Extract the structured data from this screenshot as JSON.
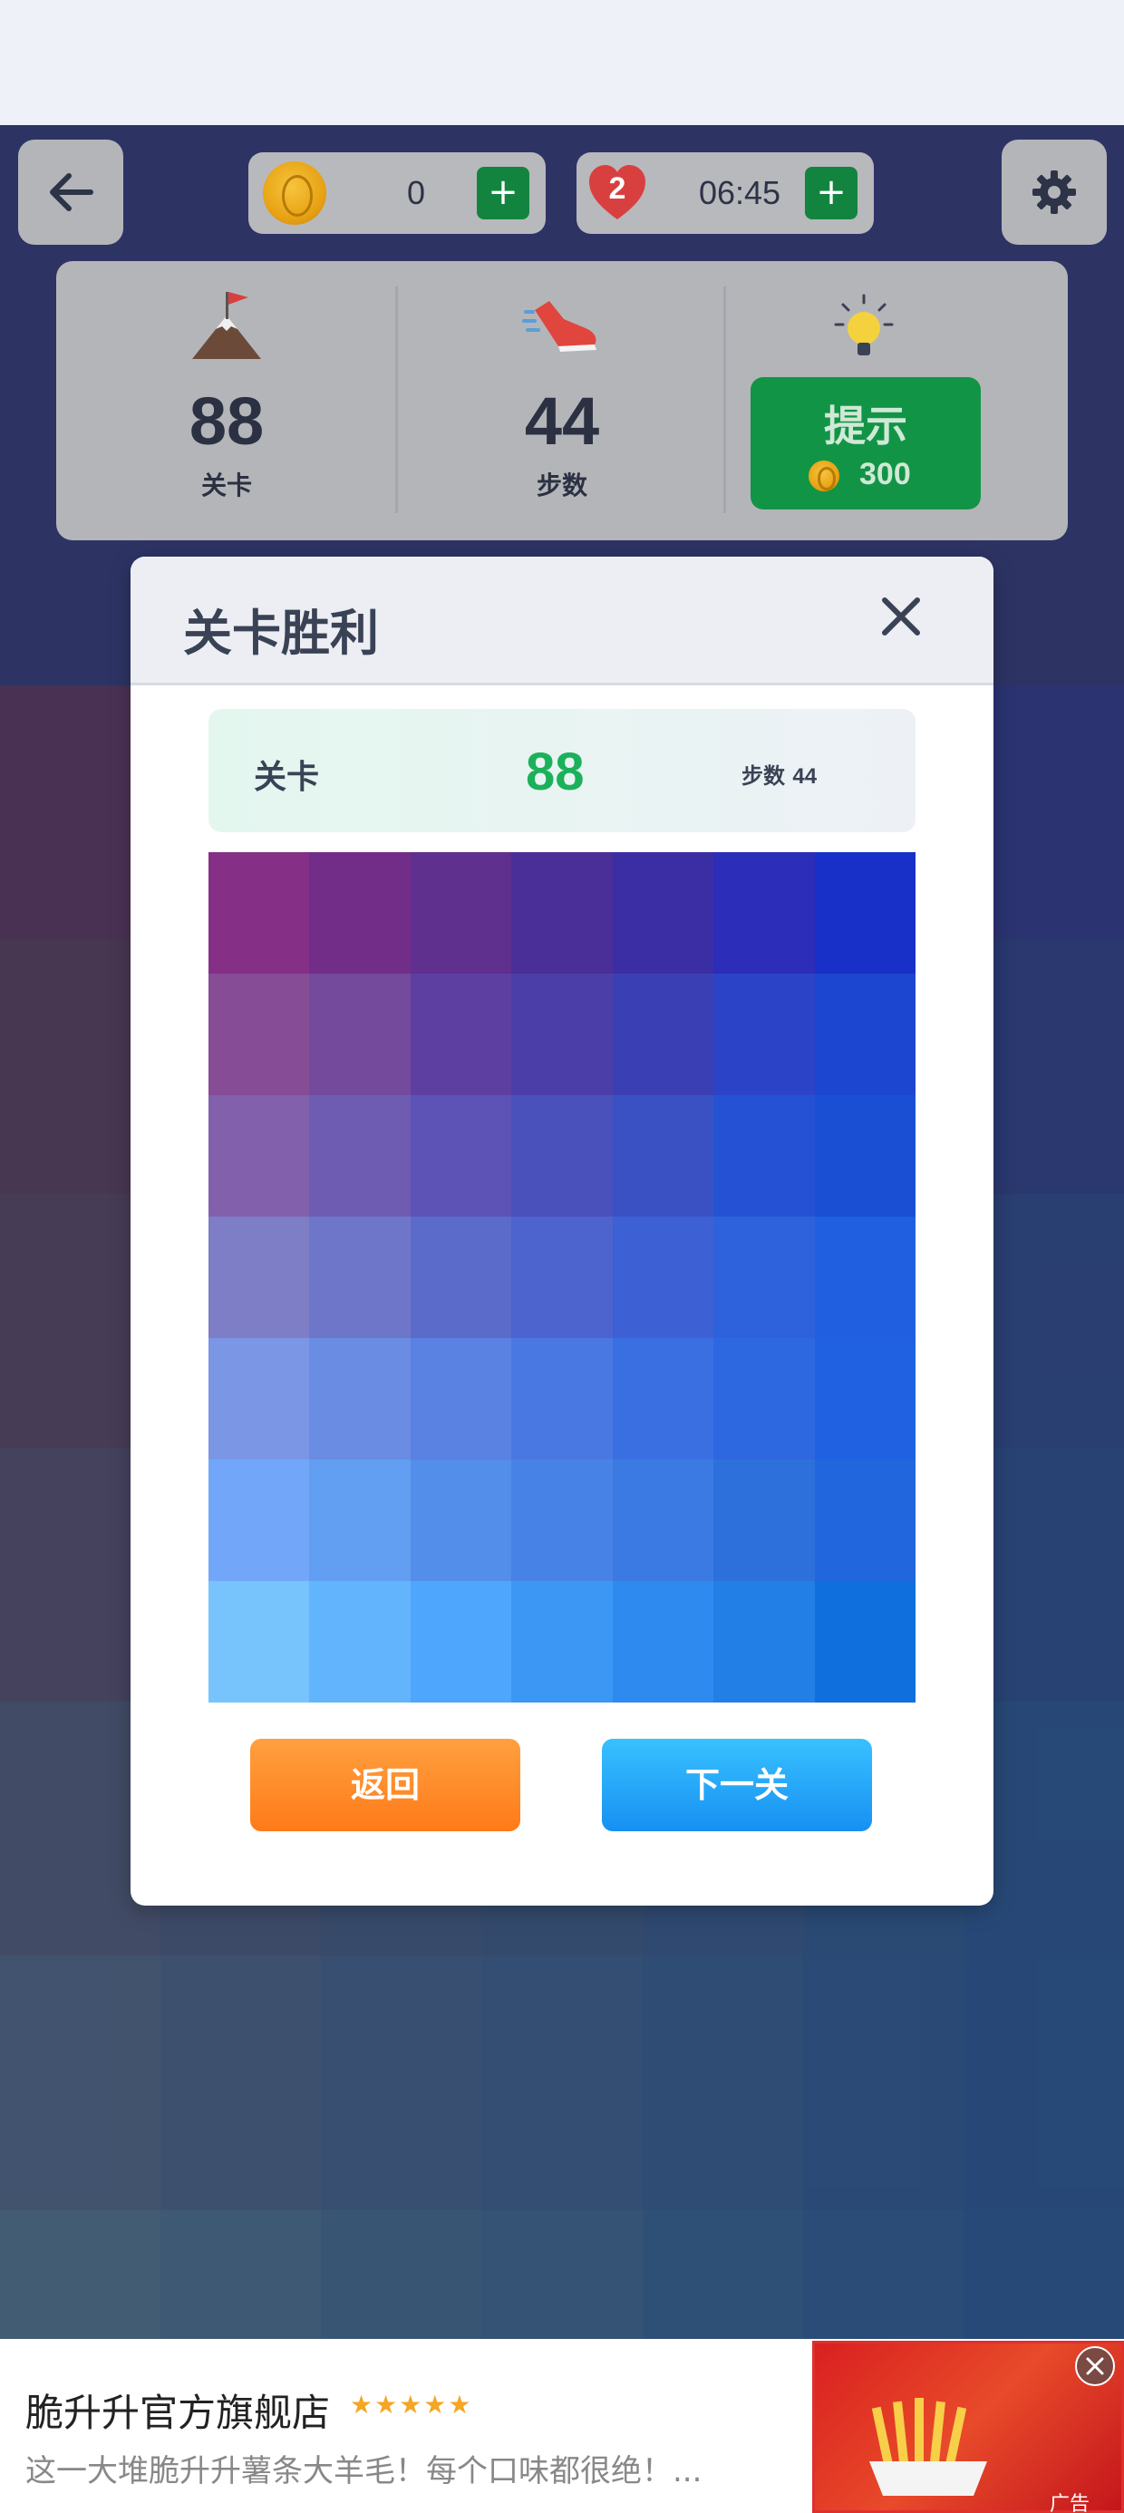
{
  "topbar": {
    "coins": "0",
    "lives": "2",
    "timer": "06:45",
    "plus": "+"
  },
  "stats": {
    "level_value": "88",
    "level_label": "关卡",
    "steps_value": "44",
    "steps_label": "步数",
    "hint_label": "提示",
    "hint_cost": "300"
  },
  "modal": {
    "title": "关卡胜利",
    "level_label": "关卡",
    "level_value": "88",
    "steps_text": "步数",
    "steps_value": "44",
    "back_label": "返回",
    "next_label": "下一关",
    "grid_colors": [
      [
        "#862f86",
        "#722d88",
        "#60308e",
        "#4a2f98",
        "#3b2ea5",
        "#2c2db9",
        "#1830c8"
      ],
      [
        "#864c96",
        "#734a9c",
        "#5d3fa2",
        "#4b3ea8",
        "#3b3fb4",
        "#2b43c7",
        "#1c46cf"
      ],
      [
        "#8260ac",
        "#6e5cb3",
        "#5d52b6",
        "#4a51bb",
        "#3a51c3",
        "#2552d4",
        "#1b4fd3"
      ],
      [
        "#7d7ec6",
        "#6d76c8",
        "#5b6bc9",
        "#4d64ce",
        "#3d60d4",
        "#2e62dd",
        "#1f5fe0"
      ],
      [
        "#7a96e4",
        "#6a8ce2",
        "#5a82e2",
        "#4a78e3",
        "#3a6fe2",
        "#2d68e0",
        "#1f61e1"
      ],
      [
        "#72a6f8",
        "#629ef2",
        "#528eea",
        "#4783e6",
        "#3a7ae2",
        "#2d70dc",
        "#2166dc"
      ],
      [
        "#77c4fc",
        "#62b4fd",
        "#4ea6fd",
        "#3c97f4",
        "#2e8aee",
        "#227fe6",
        "#0f6fdc"
      ]
    ]
  },
  "board": {
    "grid_colors": [
      [
        "#5a2565",
        "#4b266d",
        "#3d2777",
        "#322882",
        "#282a8e",
        "#1e2a99",
        "#1729a6"
      ],
      [
        "#55315f",
        "#473069",
        "#3a2f73",
        "#2f307e",
        "#253189",
        "#1c3295",
        "#1533a2"
      ],
      [
        "#523c6a",
        "#463b72",
        "#3a3c7c",
        "#2e3d86",
        "#243e90",
        "#1a3f9b",
        "#1340a6"
      ],
      [
        "#4f4b7a",
        "#434b80",
        "#374b88",
        "#2c4c91",
        "#224c9a",
        "#184ca2",
        "#104caa"
      ],
      [
        "#4a5d8c",
        "#3f5c91",
        "#345b98",
        "#2a5b9e",
        "#2059a5",
        "#1659ab",
        "#0e58b2"
      ],
      [
        "#4a6fa0",
        "#3e6ba2",
        "#3367a6",
        "#2963aa",
        "#1f60ad",
        "#165cb0",
        "#0e58b3"
      ],
      [
        "#4a84aa",
        "#3f7dac",
        "#3476ae",
        "#2a6fb0",
        "#2068b1",
        "#1760b2",
        "#0f59b3"
      ]
    ]
  },
  "ad": {
    "title": "脆升升官方旗舰店",
    "stars": "★★★★★",
    "description": "这一大堆脆升升薯条大羊毛！每个口味都很绝！...",
    "tag": "广告"
  }
}
